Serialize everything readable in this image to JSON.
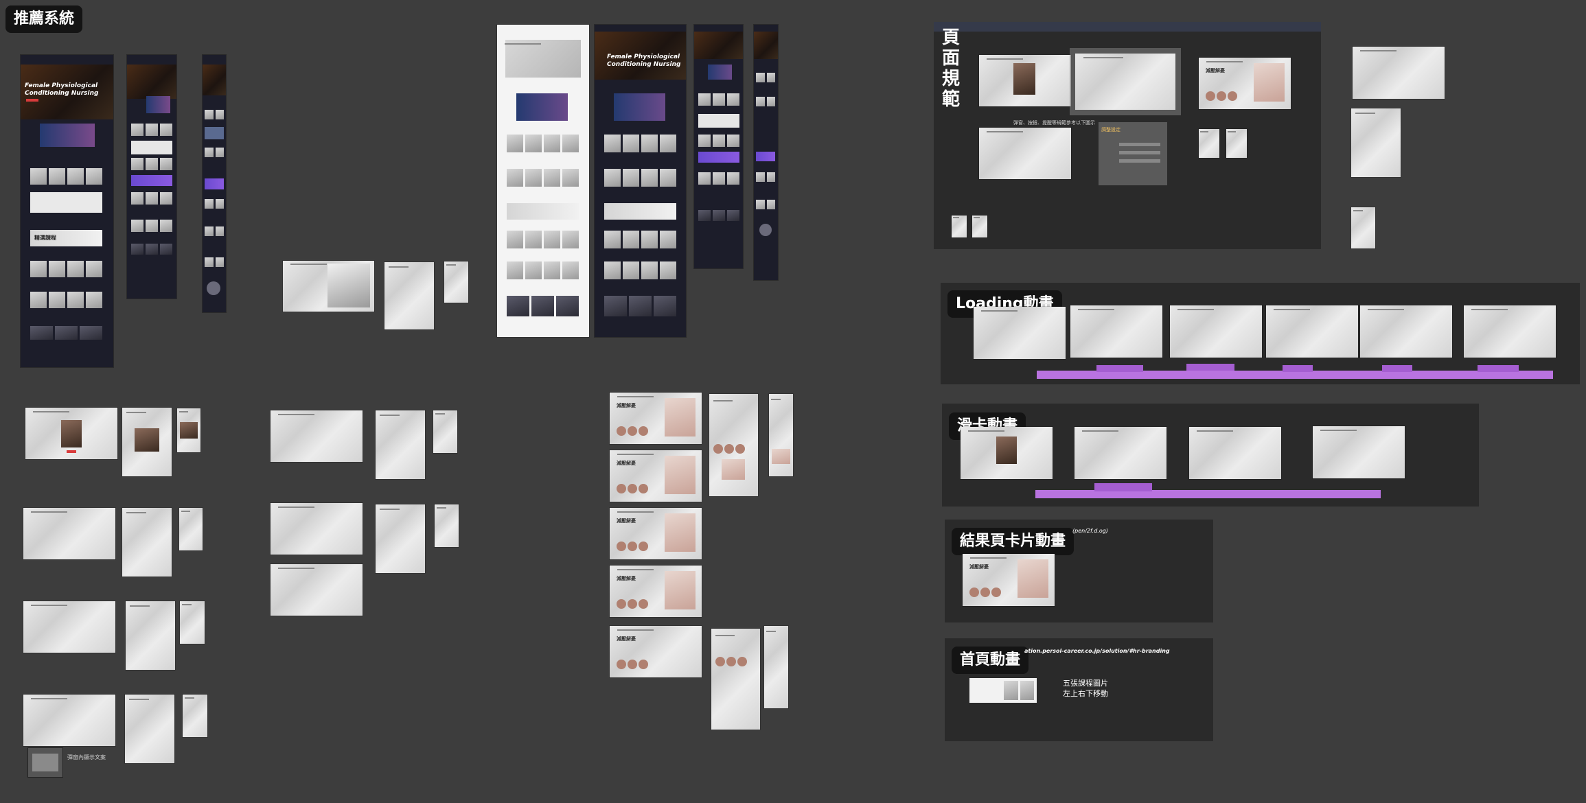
{
  "sections": {
    "recommend_system": "推薦系統",
    "page_spec_chars": [
      "頁",
      "面",
      "規",
      "範"
    ],
    "loading_anim": "Loading動畫",
    "swipe_anim": "滑卡動畫",
    "result_card_anim": "結果頁卡片動畫",
    "home_anim": "首頁動畫"
  },
  "hero_text": {
    "line1": "Female Physiological",
    "line2": "Conditioning Nursing"
  },
  "banner_text": "精選課程",
  "result_title": "減壓解憂",
  "notes": {
    "home_anim_url": "ation.persol-career.co.jp/solution/#hr-branding",
    "result_card_link": "(pen/2f.d.og)",
    "home_anim_desc1": "五張課程圖片",
    "home_anim_desc2": "左上右下移動",
    "popup_note": "彈窗內顯示文案",
    "spec_caption": "彈窗、按鈕、提醒等規範參考以下圖示",
    "spec_panel_title": "調整設定"
  },
  "colors": {
    "canvas": "#3d3d3d",
    "panel": "#2a2a2a",
    "label_bg": "#141414",
    "accent_purple": "#b973e0",
    "accent_red": "#d83b3b"
  }
}
